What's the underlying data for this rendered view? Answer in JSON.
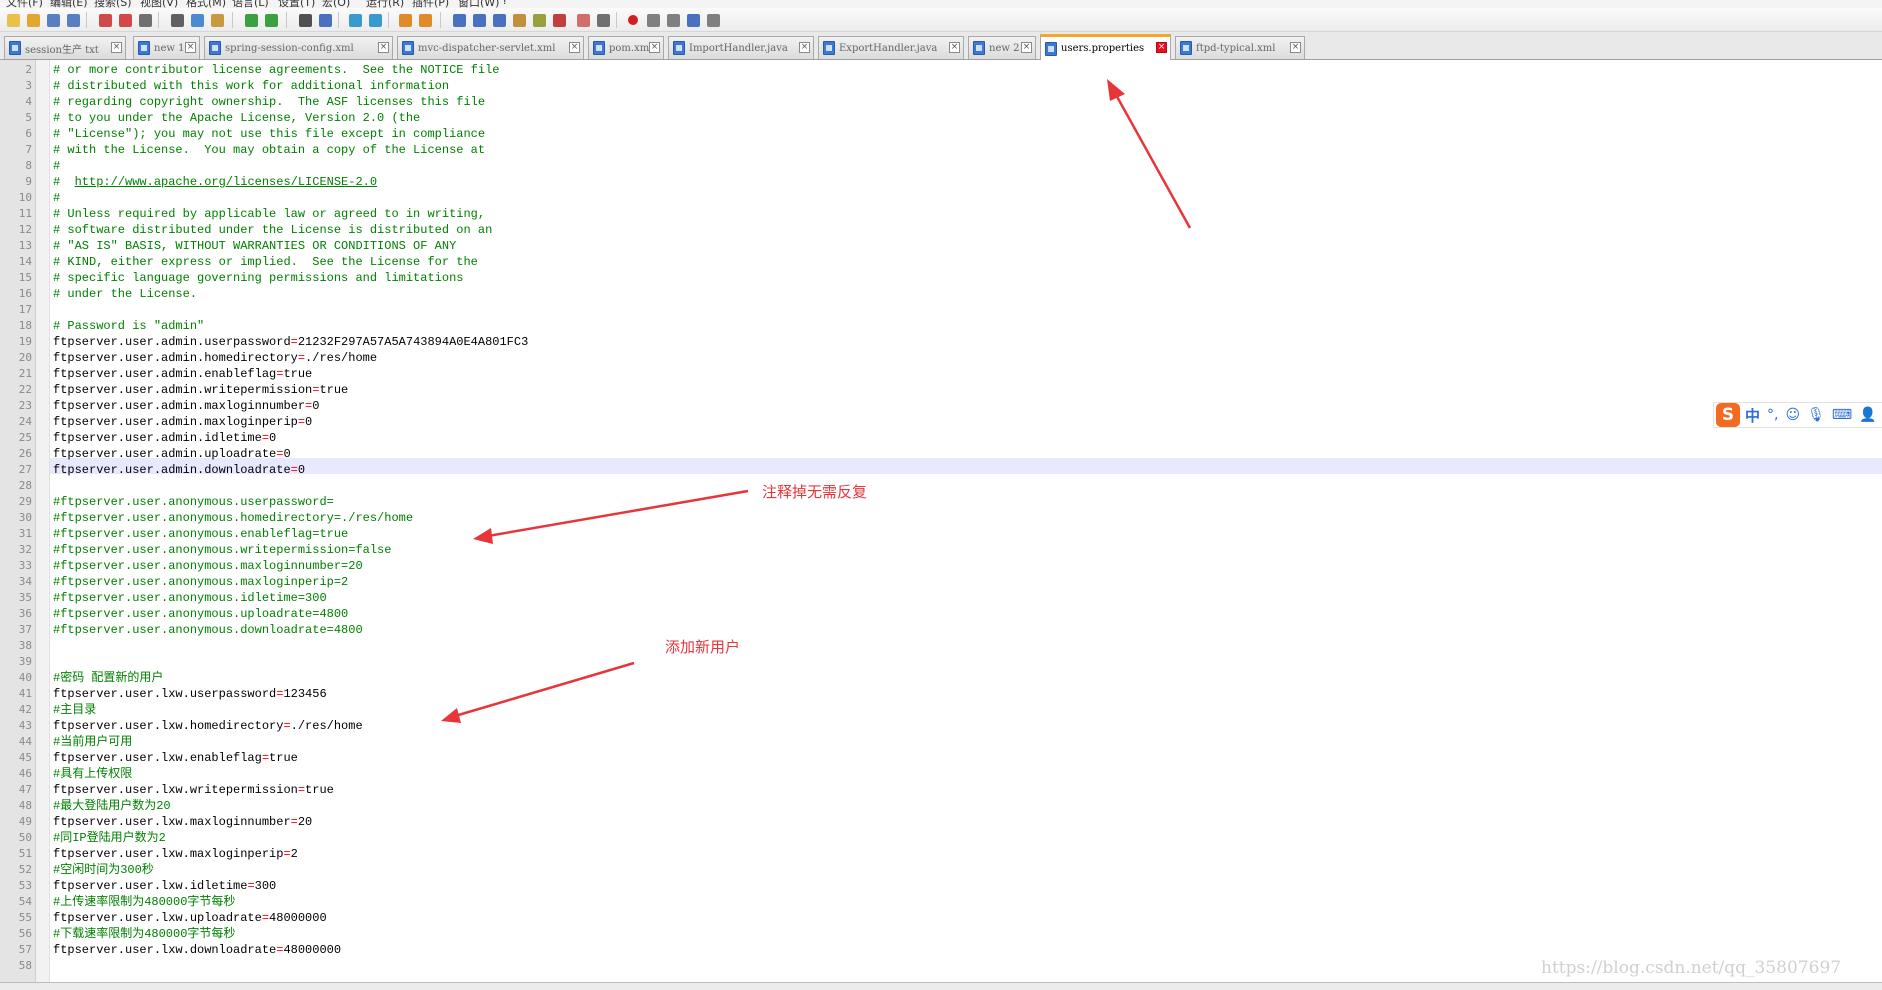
{
  "menubar": {
    "items": [
      "文件(F)",
      "编辑(E)",
      "搜索(S)",
      "视图(V)",
      "格式(M)",
      "语言(L)",
      "设置(T)",
      "宏(O)",
      "运行(R)",
      "插件(P)",
      "窗口(W)",
      "?"
    ]
  },
  "toolbar": {
    "buttons": [
      {
        "name": "new-file-icon",
        "color": "#e8c04a"
      },
      {
        "name": "open-file-icon",
        "color": "#e0a830"
      },
      {
        "name": "save-icon",
        "color": "#5a7fc0"
      },
      {
        "name": "save-all-icon",
        "color": "#5a7fc0"
      },
      {
        "name": "close-icon",
        "color": "#d04a4a"
      },
      {
        "name": "close-all-icon",
        "color": "#d04a4a"
      },
      {
        "name": "print-icon",
        "color": "#707070"
      },
      {
        "name": "cut-icon",
        "color": "#606060"
      },
      {
        "name": "copy-icon",
        "color": "#4a8ad0"
      },
      {
        "name": "paste-icon",
        "color": "#c89a40"
      },
      {
        "name": "undo-icon",
        "color": "#3aa040"
      },
      {
        "name": "redo-icon",
        "color": "#3aa040"
      },
      {
        "name": "find-icon",
        "color": "#505050"
      },
      {
        "name": "replace-icon",
        "color": "#4a70c0"
      },
      {
        "name": "zoom-in-icon",
        "color": "#3a9ad0"
      },
      {
        "name": "zoom-out-icon",
        "color": "#3a9ad0"
      },
      {
        "name": "sync-vertical-icon",
        "color": "#e08a2a"
      },
      {
        "name": "sync-horizontal-icon",
        "color": "#e08a2a"
      },
      {
        "name": "word-wrap-icon",
        "color": "#4a70c0"
      },
      {
        "name": "show-all-chars-icon",
        "color": "#4a70c0"
      },
      {
        "name": "indent-guide-icon",
        "color": "#4a70c0"
      },
      {
        "name": "user-language-icon",
        "color": "#c09040"
      },
      {
        "name": "doc-map-icon",
        "color": "#9aa040"
      },
      {
        "name": "function-list-icon",
        "color": "#c04040"
      },
      {
        "name": "folder-workspace-icon",
        "color": "#d0706a"
      },
      {
        "name": "monitoring-icon",
        "color": "#707070"
      },
      {
        "name": "record-macro-icon",
        "color": "#d02020"
      },
      {
        "name": "stop-macro-icon",
        "color": "#808080"
      },
      {
        "name": "play-macro-icon",
        "color": "#808080"
      },
      {
        "name": "run-macro-multiple-icon",
        "color": "#4a70c0"
      },
      {
        "name": "save-macro-icon",
        "color": "#808080"
      }
    ]
  },
  "tabs": [
    {
      "label": "session生产 txt",
      "active": false
    },
    {
      "label": "new 1",
      "active": false
    },
    {
      "label": "spring-session-config.xml",
      "active": false
    },
    {
      "label": "mvc-dispatcher-servlet.xml",
      "active": false
    },
    {
      "label": "pom.xml",
      "active": false
    },
    {
      "label": "ImportHandler.java",
      "active": false
    },
    {
      "label": "ExportHandler.java",
      "active": false
    },
    {
      "label": "new 2",
      "active": false
    },
    {
      "label": "users.properties",
      "active": true
    },
    {
      "label": "ftpd-typical.xml",
      "active": false
    }
  ],
  "editor": {
    "current_line": 27,
    "lines": [
      {
        "n": 2,
        "text": "# or more contributor license agreements.  See the NOTICE file"
      },
      {
        "n": 3,
        "text": "# distributed with this work for additional information"
      },
      {
        "n": 4,
        "text": "# regarding copyright ownership.  The ASF licenses this file"
      },
      {
        "n": 5,
        "text": "# to you under the Apache License, Version 2.0 (the"
      },
      {
        "n": 6,
        "text": "# \"License\"); you may not use this file except in compliance"
      },
      {
        "n": 7,
        "text": "# with the License.  You may obtain a copy of the License at"
      },
      {
        "n": 8,
        "text": "#"
      },
      {
        "n": 9,
        "text": "#  http://www.apache.org/licenses/LICENSE-2.0"
      },
      {
        "n": 10,
        "text": "#"
      },
      {
        "n": 11,
        "text": "# Unless required by applicable law or agreed to in writing,"
      },
      {
        "n": 12,
        "text": "# software distributed under the License is distributed on an"
      },
      {
        "n": 13,
        "text": "# \"AS IS\" BASIS, WITHOUT WARRANTIES OR CONDITIONS OF ANY"
      },
      {
        "n": 14,
        "text": "# KIND, either express or implied.  See the License for the"
      },
      {
        "n": 15,
        "text": "# specific language governing permissions and limitations"
      },
      {
        "n": 16,
        "text": "# under the License."
      },
      {
        "n": 17,
        "text": ""
      },
      {
        "n": 18,
        "text": "# Password is \"admin\""
      },
      {
        "n": 19,
        "text": "ftpserver.user.admin.userpassword=21232F297A57A5A743894A0E4A801FC3"
      },
      {
        "n": 20,
        "text": "ftpserver.user.admin.homedirectory=./res/home"
      },
      {
        "n": 21,
        "text": "ftpserver.user.admin.enableflag=true"
      },
      {
        "n": 22,
        "text": "ftpserver.user.admin.writepermission=true"
      },
      {
        "n": 23,
        "text": "ftpserver.user.admin.maxloginnumber=0"
      },
      {
        "n": 24,
        "text": "ftpserver.user.admin.maxloginperip=0"
      },
      {
        "n": 25,
        "text": "ftpserver.user.admin.idletime=0"
      },
      {
        "n": 26,
        "text": "ftpserver.user.admin.uploadrate=0"
      },
      {
        "n": 27,
        "text": "ftpserver.user.admin.downloadrate=0"
      },
      {
        "n": 28,
        "text": ""
      },
      {
        "n": 29,
        "text": "#ftpserver.user.anonymous.userpassword="
      },
      {
        "n": 30,
        "text": "#ftpserver.user.anonymous.homedirectory=./res/home"
      },
      {
        "n": 31,
        "text": "#ftpserver.user.anonymous.enableflag=true"
      },
      {
        "n": 32,
        "text": "#ftpserver.user.anonymous.writepermission=false"
      },
      {
        "n": 33,
        "text": "#ftpserver.user.anonymous.maxloginnumber=20"
      },
      {
        "n": 34,
        "text": "#ftpserver.user.anonymous.maxloginperip=2"
      },
      {
        "n": 35,
        "text": "#ftpserver.user.anonymous.idletime=300"
      },
      {
        "n": 36,
        "text": "#ftpserver.user.anonymous.uploadrate=4800"
      },
      {
        "n": 37,
        "text": "#ftpserver.user.anonymous.downloadrate=4800"
      },
      {
        "n": 38,
        "text": ""
      },
      {
        "n": 39,
        "text": ""
      },
      {
        "n": 40,
        "text": "#密码 配置新的用户"
      },
      {
        "n": 41,
        "text": "ftpserver.user.lxw.userpassword=123456"
      },
      {
        "n": 42,
        "text": "#主目录"
      },
      {
        "n": 43,
        "text": "ftpserver.user.lxw.homedirectory=./res/home"
      },
      {
        "n": 44,
        "text": "#当前用户可用"
      },
      {
        "n": 45,
        "text": "ftpserver.user.lxw.enableflag=true"
      },
      {
        "n": 46,
        "text": "#具有上传权限"
      },
      {
        "n": 47,
        "text": "ftpserver.user.lxw.writepermission=true"
      },
      {
        "n": 48,
        "text": "#最大登陆用户数为20"
      },
      {
        "n": 49,
        "text": "ftpserver.user.lxw.maxloginnumber=20"
      },
      {
        "n": 50,
        "text": "#同IP登陆用户数为2"
      },
      {
        "n": 51,
        "text": "ftpserver.user.lxw.maxloginperip=2"
      },
      {
        "n": 52,
        "text": "#空闲时间为300秒"
      },
      {
        "n": 53,
        "text": "ftpserver.user.lxw.idletime=300"
      },
      {
        "n": 54,
        "text": "#上传速率限制为480000字节每秒"
      },
      {
        "n": 55,
        "text": "ftpserver.user.lxw.uploadrate=48000000"
      },
      {
        "n": 56,
        "text": "#下载速率限制为480000字节每秒"
      },
      {
        "n": 57,
        "text": "ftpserver.user.lxw.downloadrate=48000000"
      },
      {
        "n": 58,
        "text": ""
      }
    ]
  },
  "annotations": {
    "comment_out_label": "注释掉无需反复",
    "add_user_label": "添加新用户",
    "arrow_color": "#e8353a"
  },
  "ime": {
    "logo": "S",
    "mode": "中",
    "icons": [
      "punctuation-icon",
      "emoji-icon",
      "microphone-icon",
      "keyboard-icon",
      "user-icon"
    ]
  },
  "watermark": "https://blog.csdn.net/qq_35807697",
  "colors": {
    "comment": "#008000",
    "operator": "#ff0000",
    "current_line": "#e8e8ff",
    "active_tab_accent": "#f5a623"
  }
}
